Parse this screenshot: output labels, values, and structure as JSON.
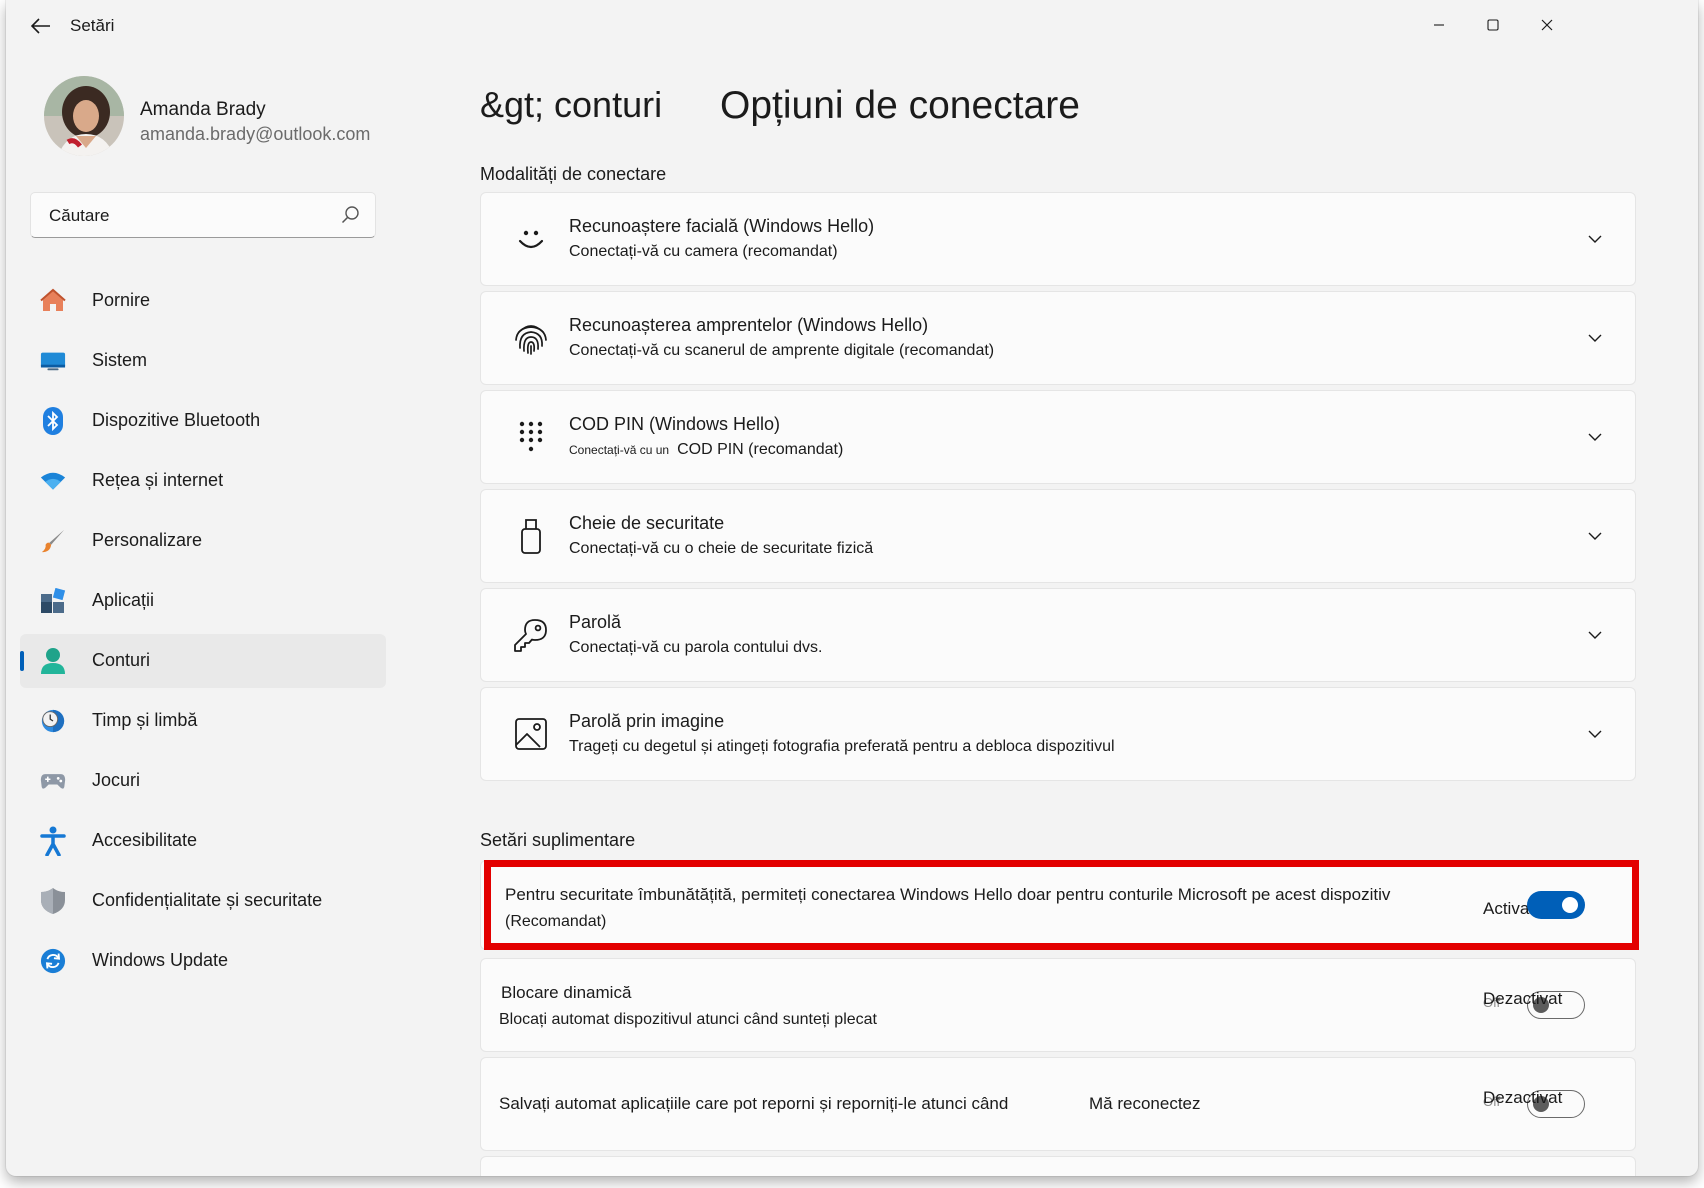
{
  "window": {
    "title": "Setări"
  },
  "profile": {
    "name": "Amanda Brady",
    "email": "amanda.brady@outlook.com"
  },
  "search": {
    "placeholder": "Căutare"
  },
  "nav": [
    {
      "label": "Pornire",
      "icon": "home-icon"
    },
    {
      "label": "Sistem",
      "icon": "system-icon"
    },
    {
      "label": "Dispozitive Bluetooth",
      "icon": "bluetooth-icon"
    },
    {
      "label": "Rețea și internet",
      "icon": "wifi-icon"
    },
    {
      "label": "Personalizare",
      "icon": "brush-icon"
    },
    {
      "label": "Aplicații",
      "icon": "apps-icon"
    },
    {
      "label": "Conturi",
      "icon": "account-icon",
      "active": true
    },
    {
      "label": "Timp și limbă",
      "icon": "time-language-icon"
    },
    {
      "label": "Jocuri",
      "icon": "gamepad-icon"
    },
    {
      "label": "Accesibilitate",
      "icon": "accessibility-icon"
    },
    {
      "label": "Confidențialitate și securitate",
      "icon": "shield-icon"
    },
    {
      "label": "Windows Update",
      "icon": "windows-update-icon"
    }
  ],
  "breadcrumb": {
    "parent": "&gt; conturi",
    "current": "Opțiuni de conectare"
  },
  "signin_section": {
    "title": "Modalități de conectare",
    "methods": [
      {
        "title": "Recunoaștere facială (Windows Hello)",
        "desc": "Conectați-vă cu camera (recomandat)",
        "icon": "face-icon"
      },
      {
        "title": "Recunoașterea amprentelor (Windows Hello)",
        "desc": "Conectați-vă cu scanerul de amprente digitale (recomandat)",
        "icon": "fingerprint-icon"
      },
      {
        "title": "COD PIN (Windows Hello)",
        "desc_small": "Conectați-vă cu un",
        "desc": "COD PIN (recomandat)",
        "icon": "pin-keypad-icon"
      },
      {
        "title": "Cheie de securitate",
        "desc": "Conectați-vă cu o cheie de securitate fizică",
        "icon": "security-key-icon"
      },
      {
        "title": "Parolă",
        "desc": "Conectați-vă cu parola contului dvs.",
        "icon": "key-icon"
      },
      {
        "title": "Parolă prin imagine",
        "desc": "Trageți cu degetul și atingeți fotografia preferată pentru a debloca dispozitivul",
        "icon": "picture-icon"
      }
    ]
  },
  "additional_section": {
    "title": "Setări suplimentare",
    "hello_only": {
      "text": "Pentru securitate îmbunătățită, permiteți conectarea Windows Hello doar pentru conturile Microsoft pe acest dispozitiv",
      "sub": "(Recomandat)",
      "state_label": "Activat",
      "on": true
    },
    "dynamic_lock": {
      "title": "Blocare dinamică",
      "desc": "Blocați automat dispozitivul atunci când sunteți plecat",
      "state_label": "Dezactivat",
      "state_ghost": "Off",
      "on": false
    },
    "restart_apps": {
      "text": "Salvați automat aplicațiile care pot reporni și reporniți-le atunci când",
      "text2": "Mă reconectez",
      "state_label": "Dezactivat",
      "state_ghost": "Off",
      "on": false
    }
  },
  "colors": {
    "accent": "#005fb8",
    "highlight": "#e30000",
    "background": "#f3f3f3",
    "card": "#fbfbfb"
  }
}
